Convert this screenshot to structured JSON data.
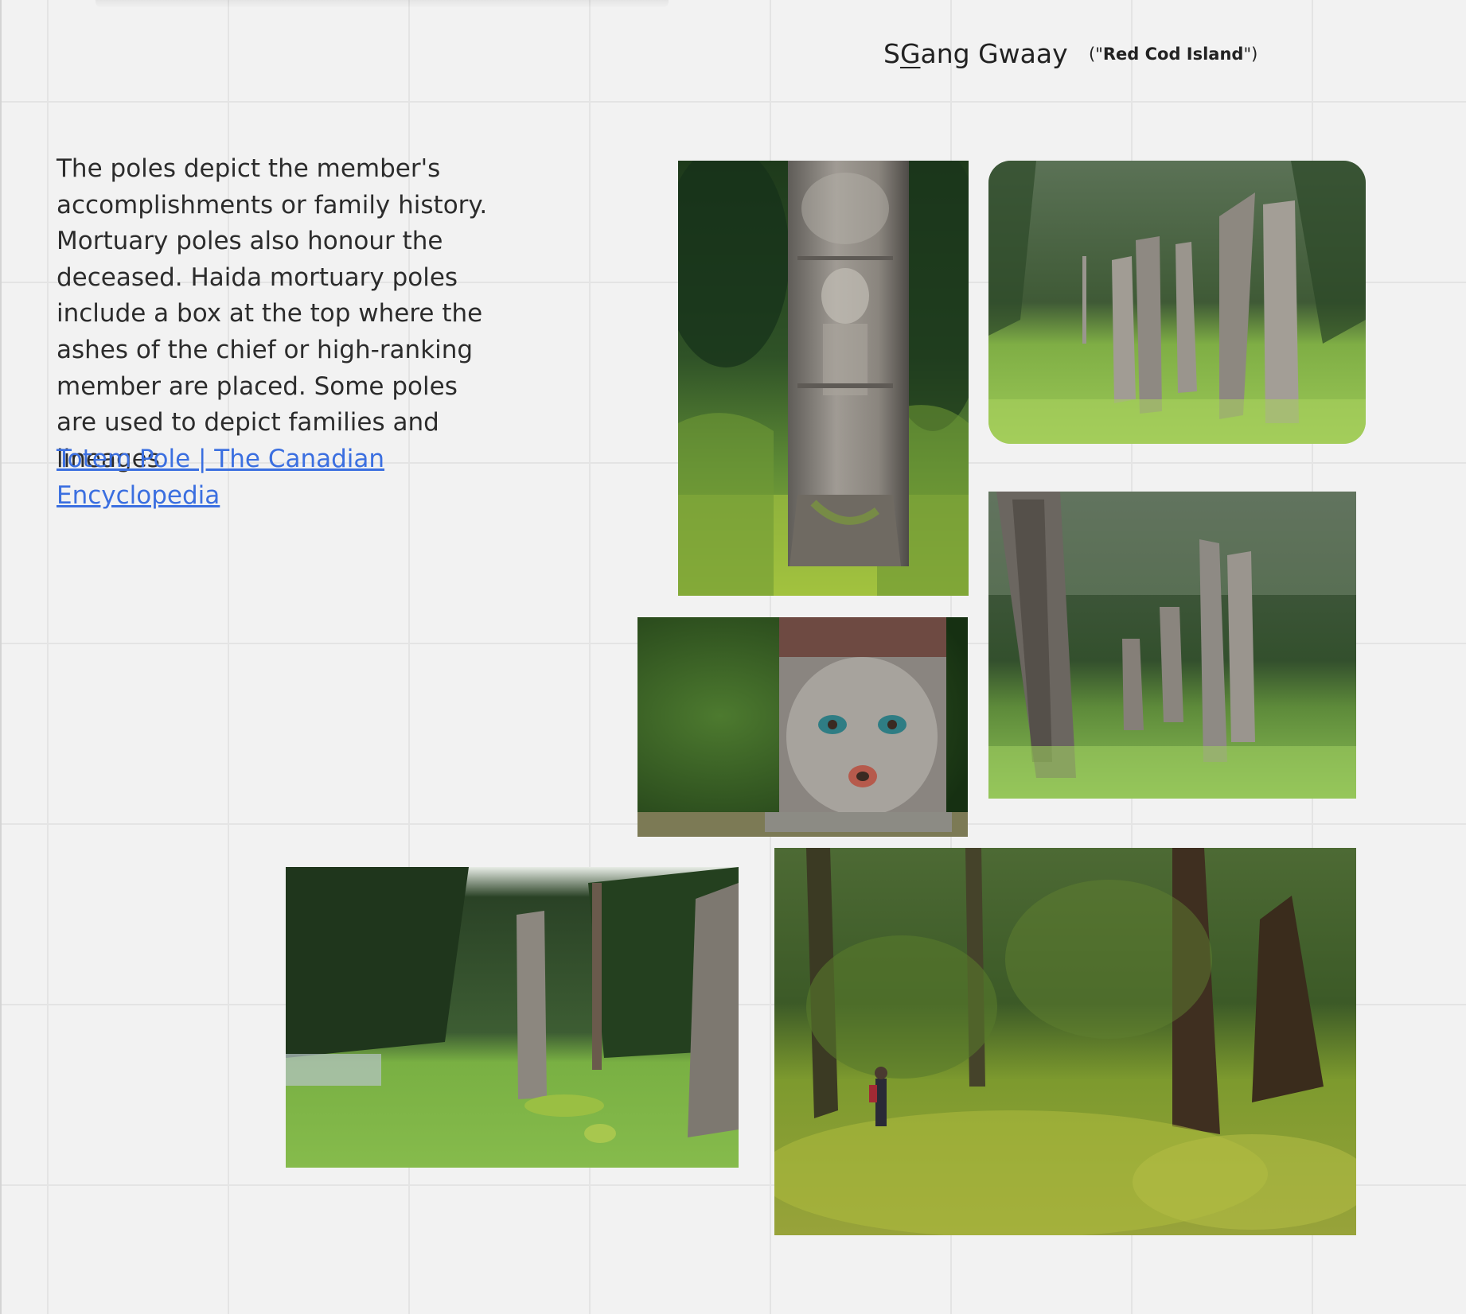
{
  "header": {
    "title_prefix": "S",
    "title_underlined": "G",
    "title_suffix": "ang Gwaay",
    "subtitle_open": "(\"",
    "subtitle_bold": "Red Cod Island",
    "subtitle_close": "\")"
  },
  "description": "The poles depict the member's accomplishments or family history. Mortuary poles also honour the deceased. Haida mortuary poles include a box at the top where the ashes of the chief or high-ranking member are placed. Some poles are used to depict families and lineages",
  "link": {
    "text": "Totem Pole | The Canadian Encyclopedia"
  },
  "colors": {
    "canvas": "#f2f2f2",
    "grid": "#e4e4e4",
    "link": "#3b6fe0",
    "forest_dark": "#1f3a1c",
    "moss": "#8fb23c",
    "grass": "#7dbb4a",
    "weathered_wood": "#8a8680"
  },
  "photos": [
    {
      "id": "single-carved-pole",
      "icon": "totem-pole-photo"
    },
    {
      "id": "row-of-poles",
      "icon": "totem-poles-photo"
    },
    {
      "id": "carved-face",
      "icon": "carved-face-photo"
    },
    {
      "id": "misty-poles",
      "icon": "forest-poles-photo"
    },
    {
      "id": "village-site",
      "icon": "village-poles-photo"
    },
    {
      "id": "mossy-rainforest",
      "icon": "rainforest-photo"
    }
  ]
}
